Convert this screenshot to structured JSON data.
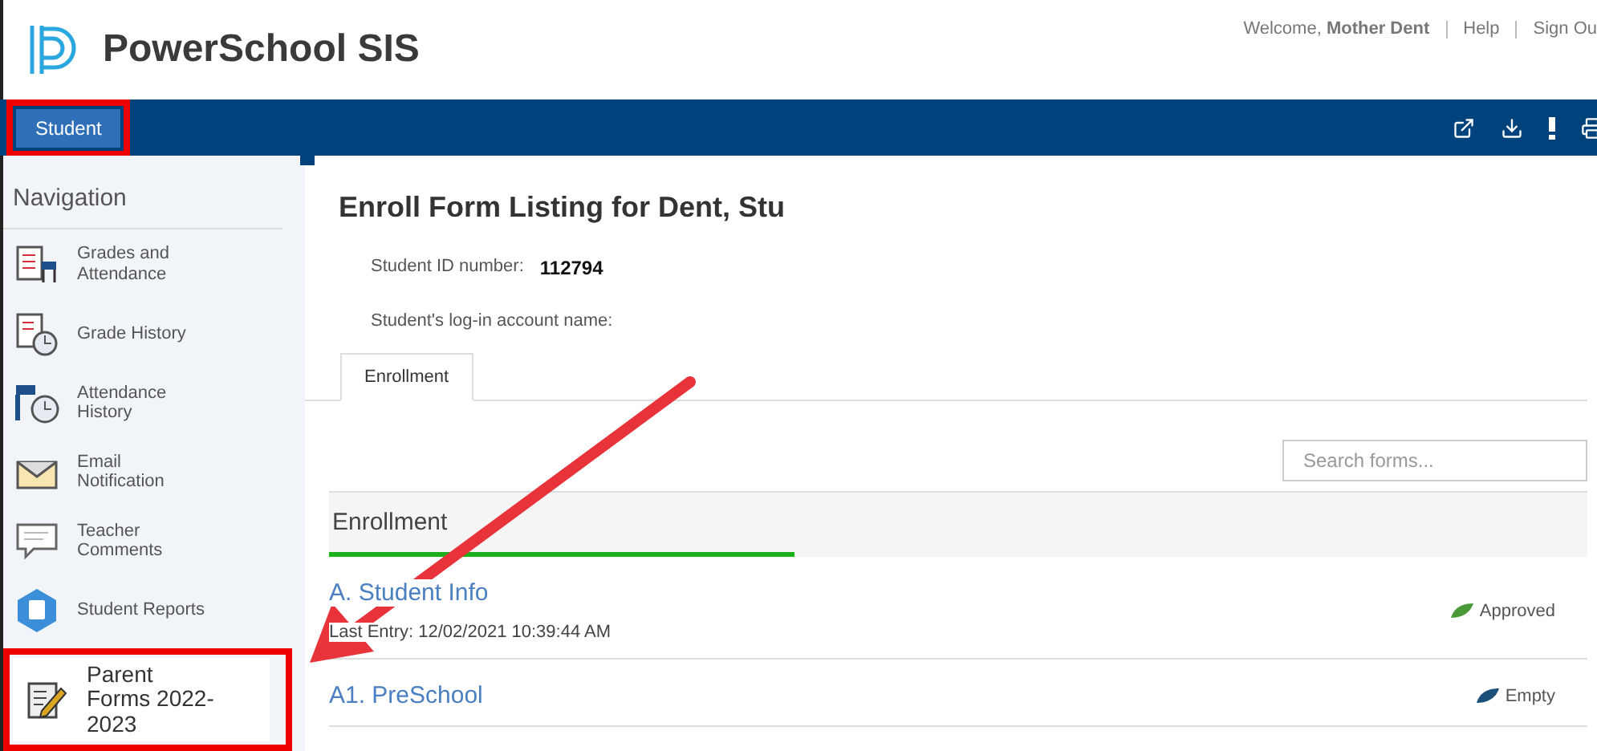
{
  "header": {
    "logo_text": "PowerSchool SIS",
    "welcome": "Welcome, **Mother Dent**",
    "links": [
      "Help",
      "Sign Ou"
    ]
  },
  "nav_bar": {
    "tabs": [
      {
        "label": "Student",
        "selected": true,
        "annotated": true
      }
    ]
  },
  "sidebar": {
    "title": "Navigation",
    "items": [
      {
        "label": "Grades and Attendance",
        "kind": "grades",
        "annotated": false
      },
      {
        "label": "Grade History",
        "kind": "history",
        "annotated": false
      },
      {
        "label": "Attendance History",
        "kind": "attendance",
        "annotated": false
      },
      {
        "label": "Email Notification",
        "kind": "email",
        "annotated": false
      },
      {
        "label": "Teacher Comments",
        "kind": "comments",
        "annotated": false
      },
      {
        "label": "Student Reports",
        "kind": "reports",
        "annotated": false
      },
      {
        "label": "Parent Forms 2022-2023",
        "kind": "forms",
        "annotated": true
      }
    ]
  },
  "main": {
    "title": "Enroll Form Listing for Dent, Stu",
    "fields": [
      {
        "label": "Student ID number:",
        "value": "112794"
      },
      {
        "label": "Student's log-in account name:"
      }
    ],
    "tabs": [
      {
        "label": "Enrollment",
        "selected": true
      }
    ],
    "search": {
      "placeholder": "Search forms..."
    },
    "section": {
      "title": "Enrollment",
      "level": 0.37
    },
    "forms": [
      {
        "title": "A. Student Info",
        "last_entry": "Last Entry: 12/02/2021 10:39:44 AM",
        "status": "Approved",
        "color": "#4a9a3a"
      },
      {
        "title": "A1. PreSchool",
        "status": "Empty",
        "color": "#1c4f7a"
      }
    ]
  }
}
